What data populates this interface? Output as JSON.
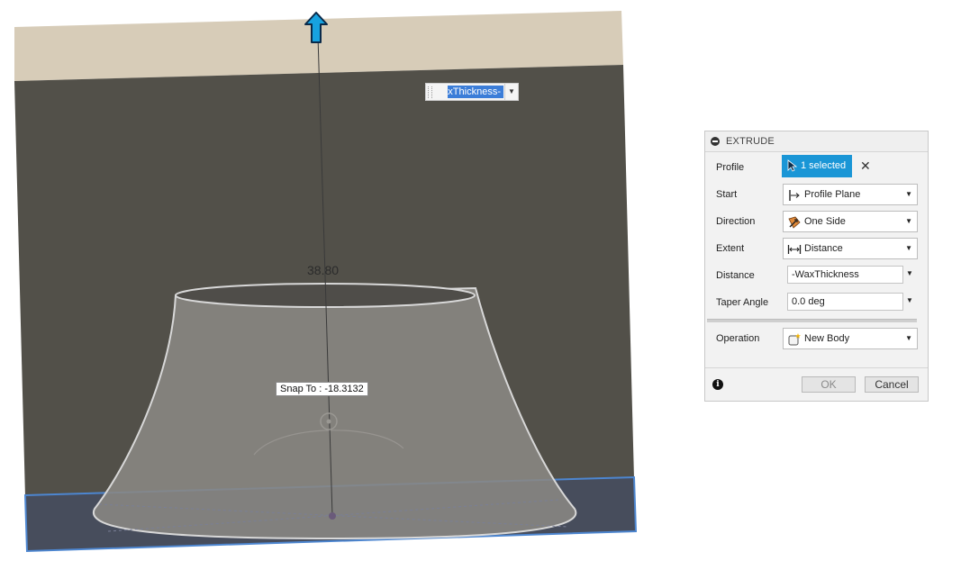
{
  "viewport": {
    "dimension_label": "38.80",
    "snap_tooltip": "Snap To : -18.3132",
    "distance_input_text": "-WaxThickness",
    "icons": [
      "up-arrow-manipulator-icon",
      "dropdown-caret-icon"
    ]
  },
  "panel": {
    "title": "EXTRUDE",
    "rows": {
      "profile": {
        "label": "Profile",
        "value": "1 selected"
      },
      "start": {
        "label": "Start",
        "value": "Profile Plane"
      },
      "direction": {
        "label": "Direction",
        "value": "One Side"
      },
      "extent": {
        "label": "Extent",
        "value": "Distance"
      },
      "distance": {
        "label": "Distance",
        "value": "-WaxThickness"
      },
      "taper": {
        "label": "Taper Angle",
        "value": "0.0 deg"
      },
      "operation": {
        "label": "Operation",
        "value": "New Body"
      }
    },
    "buttons": {
      "ok": "OK",
      "cancel": "Cancel"
    }
  },
  "colors": {
    "sky": "#d7ccb8",
    "backdrop": "#525049",
    "plane": "#4a5060",
    "accent": "#1a96d6"
  }
}
